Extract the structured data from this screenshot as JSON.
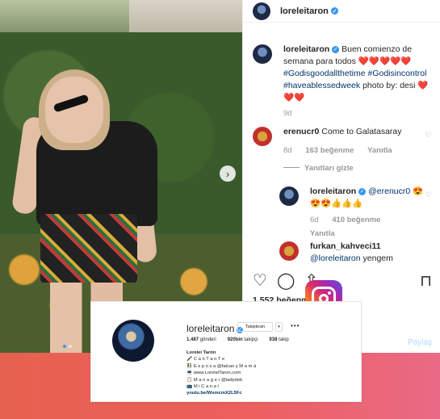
{
  "post": {
    "username": "loreleitaron",
    "caption_text": "Buen comienzo de semana para todos",
    "caption_hearts": "❤️❤️❤️❤️❤️",
    "hashtags": "#Godisgoodallthetime #Godisincontrol #haveablessedweek",
    "credit": "photo by: desi",
    "trailing_hearts": "❤️❤️❤️",
    "caption_time": "9d",
    "likes_prefix": "1.552 beğenme",
    "add_comment": "Paylaş"
  },
  "comments": [
    {
      "username": "erenucr0",
      "text": "Come to Galatasaray",
      "time": "8d",
      "likes": "163 beğenme",
      "reply_label": "Yanıtla",
      "hide_replies": "Yanıtları gizle"
    },
    {
      "username": "loreleitaron",
      "mention": "@erenucr0",
      "emojis_1": "😍",
      "emojis_2": "😍😍👍👍👍",
      "time": "6d",
      "likes": "410 beğenme",
      "reply_label": "Yanıtla"
    },
    {
      "username": "furkan_kahveci11",
      "mention": "@loreleitaron",
      "text": "yengem"
    }
  ],
  "photo": {
    "next_arrow": "›"
  },
  "profile": {
    "username": "loreleitaron",
    "follow_button": "Takiptesin",
    "dropdown": "▾",
    "more": "•••",
    "posts": "1.487",
    "posts_label": "gönderi",
    "followers": "920bin",
    "followers_label": "takipçi",
    "following": "938",
    "following_label": "takip",
    "full_name": "Lorelei Tarón",
    "bio_lines": [
      "🎤 C a n T a n T e",
      "👫 E s p o s a @falcao y M a m á",
      "💻 www.LoreleiTaron.com",
      "📋 M a n a g e r @ladydeb",
      "📺 M i C a n a l"
    ],
    "link": "youtu.be/WsmcmX2L5Fc"
  },
  "colors": {
    "band_start": "#e7614f",
    "band_end": "#ea6a86",
    "verified": "#3897f0",
    "link": "#003569"
  }
}
